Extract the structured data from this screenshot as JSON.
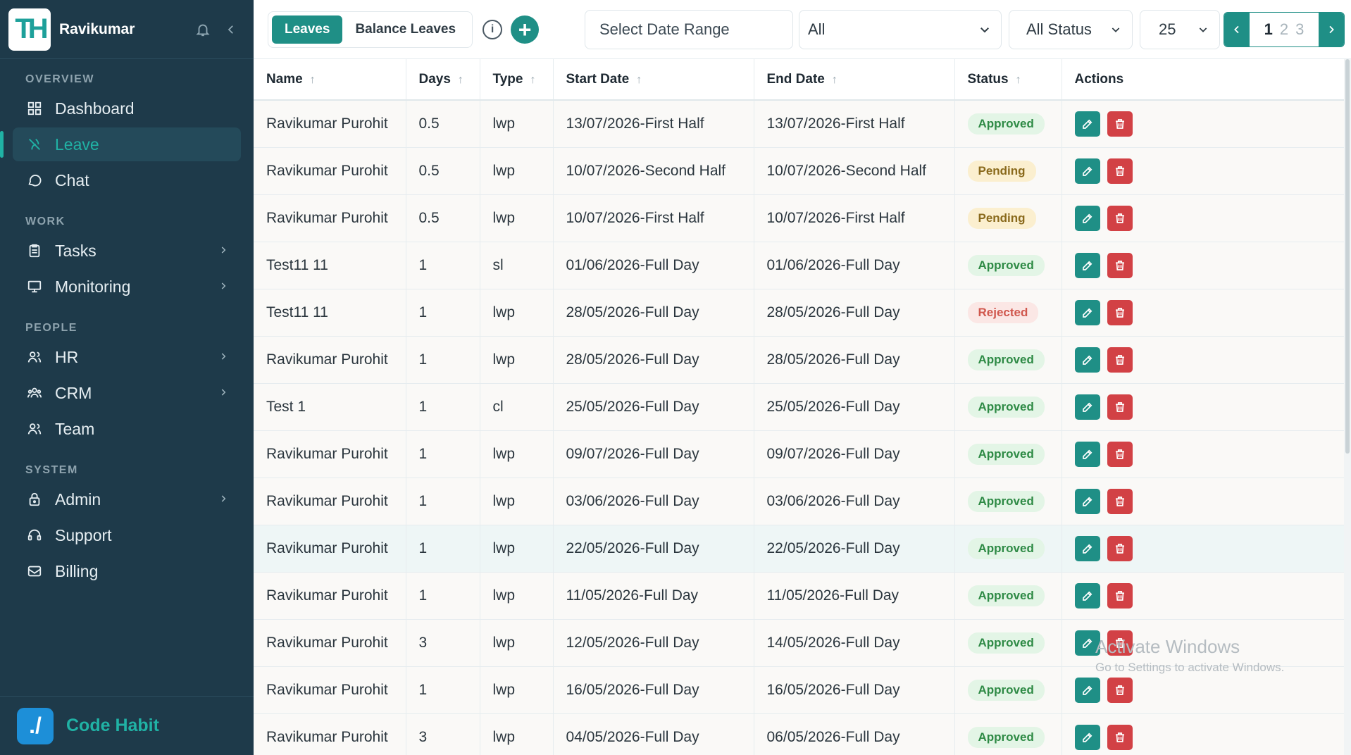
{
  "brand": {
    "name": "Ravikumar",
    "logo_text": "TH"
  },
  "nav": {
    "sections": [
      {
        "title": "OVERVIEW",
        "items": [
          {
            "label": "Dashboard",
            "icon": "dashboard-icon",
            "active": false,
            "has_children": false
          },
          {
            "label": "Leave",
            "icon": "leave-icon",
            "active": true,
            "has_children": false
          },
          {
            "label": "Chat",
            "icon": "chat-icon",
            "active": false,
            "has_children": false
          }
        ]
      },
      {
        "title": "WORK",
        "items": [
          {
            "label": "Tasks",
            "icon": "tasks-icon",
            "active": false,
            "has_children": true
          },
          {
            "label": "Monitoring",
            "icon": "monitor-icon",
            "active": false,
            "has_children": true
          }
        ]
      },
      {
        "title": "PEOPLE",
        "items": [
          {
            "label": "HR",
            "icon": "hr-icon",
            "active": false,
            "has_children": true
          },
          {
            "label": "CRM",
            "icon": "crm-icon",
            "active": false,
            "has_children": true
          },
          {
            "label": "Team",
            "icon": "team-icon",
            "active": false,
            "has_children": false
          }
        ]
      },
      {
        "title": "SYSTEM",
        "items": [
          {
            "label": "Admin",
            "icon": "lock-icon",
            "active": false,
            "has_children": true
          },
          {
            "label": "Support",
            "icon": "headset-icon",
            "active": false,
            "has_children": false
          },
          {
            "label": "Billing",
            "icon": "billing-icon",
            "active": false,
            "has_children": false
          }
        ]
      }
    ]
  },
  "footer": {
    "name": "Code Habit",
    "logo_text": "./"
  },
  "toolbar": {
    "tabs": [
      {
        "label": "Leaves",
        "active": true
      },
      {
        "label": "Balance Leaves",
        "active": false
      }
    ],
    "date_range_placeholder": "Select Date Range",
    "user_filter": "All",
    "status_filter": "All Status",
    "page_size": "25",
    "pages": [
      "1",
      "2",
      "3"
    ],
    "current_page": "1"
  },
  "table": {
    "columns": [
      {
        "label": "Name",
        "sortable": true
      },
      {
        "label": "Days",
        "sortable": true
      },
      {
        "label": "Type",
        "sortable": true
      },
      {
        "label": "Start Date",
        "sortable": true
      },
      {
        "label": "End Date",
        "sortable": true
      },
      {
        "label": "Status",
        "sortable": true
      },
      {
        "label": "Actions",
        "sortable": false
      }
    ],
    "rows": [
      {
        "name": "Ravikumar Purohit",
        "days": "0.5",
        "type": "lwp",
        "start": "13/07/2026-First Half",
        "end": "13/07/2026-First Half",
        "status": "Approved"
      },
      {
        "name": "Ravikumar Purohit",
        "days": "0.5",
        "type": "lwp",
        "start": "10/07/2026-Second Half",
        "end": "10/07/2026-Second Half",
        "status": "Pending"
      },
      {
        "name": "Ravikumar Purohit",
        "days": "0.5",
        "type": "lwp",
        "start": "10/07/2026-First Half",
        "end": "10/07/2026-First Half",
        "status": "Pending"
      },
      {
        "name": "Test11 11",
        "days": "1",
        "type": "sl",
        "start": "01/06/2026-Full Day",
        "end": "01/06/2026-Full Day",
        "status": "Approved"
      },
      {
        "name": "Test11 11",
        "days": "1",
        "type": "lwp",
        "start": "28/05/2026-Full Day",
        "end": "28/05/2026-Full Day",
        "status": "Rejected"
      },
      {
        "name": "Ravikumar Purohit",
        "days": "1",
        "type": "lwp",
        "start": "28/05/2026-Full Day",
        "end": "28/05/2026-Full Day",
        "status": "Approved"
      },
      {
        "name": "Test 1",
        "days": "1",
        "type": "cl",
        "start": "25/05/2026-Full Day",
        "end": "25/05/2026-Full Day",
        "status": "Approved"
      },
      {
        "name": "Ravikumar Purohit",
        "days": "1",
        "type": "lwp",
        "start": "09/07/2026-Full Day",
        "end": "09/07/2026-Full Day",
        "status": "Approved"
      },
      {
        "name": "Ravikumar Purohit",
        "days": "1",
        "type": "lwp",
        "start": "03/06/2026-Full Day",
        "end": "03/06/2026-Full Day",
        "status": "Approved"
      },
      {
        "name": "Ravikumar Purohit",
        "days": "1",
        "type": "lwp",
        "start": "22/05/2026-Full Day",
        "end": "22/05/2026-Full Day",
        "status": "Approved"
      },
      {
        "name": "Ravikumar Purohit",
        "days": "1",
        "type": "lwp",
        "start": "11/05/2026-Full Day",
        "end": "11/05/2026-Full Day",
        "status": "Approved"
      },
      {
        "name": "Ravikumar Purohit",
        "days": "3",
        "type": "lwp",
        "start": "12/05/2026-Full Day",
        "end": "14/05/2026-Full Day",
        "status": "Approved"
      },
      {
        "name": "Ravikumar Purohit",
        "days": "1",
        "type": "lwp",
        "start": "16/05/2026-Full Day",
        "end": "16/05/2026-Full Day",
        "status": "Approved"
      },
      {
        "name": "Ravikumar Purohit",
        "days": "3",
        "type": "lwp",
        "start": "04/05/2026-Full Day",
        "end": "06/05/2026-Full Day",
        "status": "Approved"
      }
    ],
    "highlighted_row": 9
  },
  "watermark": {
    "line1": "Activate Windows",
    "line2": "Go to Settings to activate Windows."
  },
  "colors": {
    "sidebar": "#1e3a4a",
    "accent": "#1f8f86",
    "danger": "#d24145",
    "approved": "#2e8a45",
    "pending": "#8a6a1c",
    "rejected": "#d0574d"
  }
}
